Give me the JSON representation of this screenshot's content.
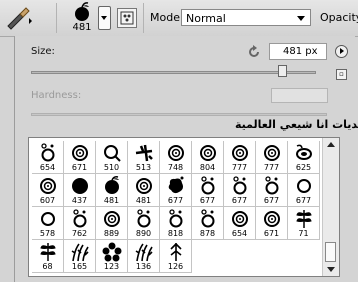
{
  "toolbar": {
    "brush_tool_icon": "brush-icon",
    "brush_size": "481",
    "toggle_panel_icon": "brush-panel-icon",
    "mode_label": "Mode:",
    "mode_value": "Normal",
    "opacity_label": "Opacity:"
  },
  "panel": {
    "size_label": "Size:",
    "size_value": "481 px",
    "reset_icon": "reset-icon",
    "size_slider_fraction": 0.88,
    "hardness_label": "Hardness:",
    "preset_group_label": "منتديات انا شيعي العالمية"
  },
  "brushes": [
    {
      "num": "654",
      "shape": "ring-dots"
    },
    {
      "num": "671",
      "shape": "double-ring"
    },
    {
      "num": "510",
      "shape": "ring-tail"
    },
    {
      "num": "513",
      "shape": "plane"
    },
    {
      "num": "748",
      "shape": "double-ring"
    },
    {
      "num": "804",
      "shape": "double-ring"
    },
    {
      "num": "777",
      "shape": "double-ring"
    },
    {
      "num": "777",
      "shape": "double-ring"
    },
    {
      "num": "625",
      "shape": "swirl"
    },
    {
      "num": "607",
      "shape": "double-ring"
    },
    {
      "num": "437",
      "shape": "solid"
    },
    {
      "num": "481",
      "shape": "apple"
    },
    {
      "num": "481",
      "shape": "double-ring"
    },
    {
      "num": "677",
      "shape": "blob"
    },
    {
      "num": "677",
      "shape": "ring-dots"
    },
    {
      "num": "677",
      "shape": "ring-dots"
    },
    {
      "num": "677",
      "shape": "ring-dots"
    },
    {
      "num": "677",
      "shape": "ring"
    },
    {
      "num": "578",
      "shape": "ring"
    },
    {
      "num": "762",
      "shape": "ring-dots"
    },
    {
      "num": "889",
      "shape": "double-ring"
    },
    {
      "num": "890",
      "shape": "ring-dots"
    },
    {
      "num": "818",
      "shape": "ring-dots"
    },
    {
      "num": "878",
      "shape": "ring-dots"
    },
    {
      "num": "654",
      "shape": "double-ring"
    },
    {
      "num": "671",
      "shape": "double-ring"
    },
    {
      "num": "71",
      "shape": "leaves"
    },
    {
      "num": "68",
      "shape": "leaves"
    },
    {
      "num": "165",
      "shape": "grass"
    },
    {
      "num": "123",
      "shape": "flower"
    },
    {
      "num": "136",
      "shape": "grass"
    },
    {
      "num": "126",
      "shape": "arrow-leaf"
    }
  ]
}
